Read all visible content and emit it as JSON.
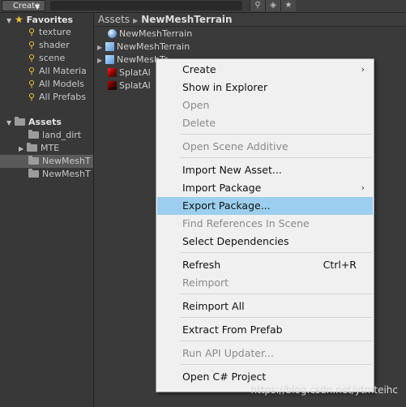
{
  "toolbar": {
    "create_label": "Create",
    "icons": [
      "filter-icon",
      "tag-icon",
      "star-icon"
    ]
  },
  "favorites": {
    "title": "Favorites",
    "items": [
      "texture",
      "shader",
      "scene",
      "All Materia",
      "All Models",
      "All Prefabs"
    ]
  },
  "assets_tree": {
    "title": "Assets",
    "items": [
      "land_dirt",
      "MTE",
      "NewMeshT",
      "NewMeshT"
    ]
  },
  "breadcrumb": {
    "root": "Assets",
    "current": "NewMeshTerrain"
  },
  "asset_list": [
    {
      "label": "NewMeshTerrain",
      "icon": "sphere-icon"
    },
    {
      "label": "NewMeshTerrain",
      "icon": "prefab-icon"
    },
    {
      "label": "NewMeshTe",
      "icon": "prefab-icon"
    },
    {
      "label": "SplatAl",
      "icon": "texture-icon"
    },
    {
      "label": "SplatAl",
      "icon": "texture-icon"
    }
  ],
  "context_menu": {
    "items": [
      {
        "label": "Create",
        "submenu": true
      },
      {
        "label": "Show in Explorer"
      },
      {
        "label": "Open",
        "disabled": true
      },
      {
        "label": "Delete",
        "disabled": true
      },
      {
        "label": "Open Scene Additive",
        "disabled": true
      },
      {
        "label": "Import New Asset..."
      },
      {
        "label": "Import Package",
        "submenu": true
      },
      {
        "label": "Export Package...",
        "highlighted": true
      },
      {
        "label": "Find References In Scene",
        "disabled": true
      },
      {
        "label": "Select Dependencies"
      },
      {
        "label": "Refresh",
        "shortcut": "Ctrl+R"
      },
      {
        "label": "Reimport",
        "disabled": true
      },
      {
        "label": "Reimport All"
      },
      {
        "label": "Extract From Prefab"
      },
      {
        "label": "Run API Updater...",
        "disabled": true
      },
      {
        "label": "Open C# Project"
      }
    ]
  },
  "watermark": "https://blog.csdn.net/ytmteihc",
  "colors": {
    "menu_highlight": "#9ccfef",
    "favorite_star": "#f2c230",
    "panel_bg": "#383838"
  }
}
